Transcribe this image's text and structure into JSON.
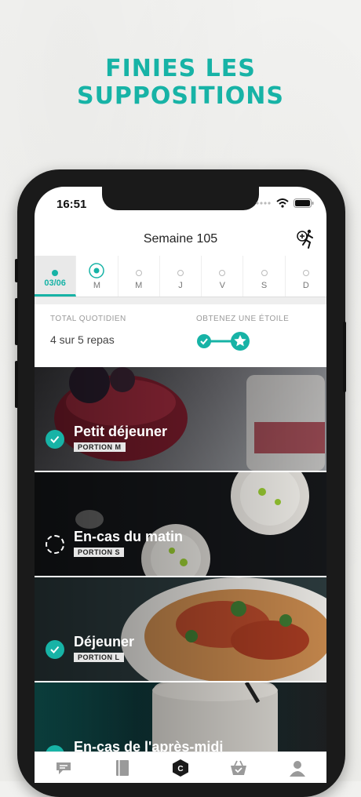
{
  "headline": "FINIES LES SUPPOSITIONS",
  "status": {
    "time": "16:51"
  },
  "header": {
    "title": "Semaine 105"
  },
  "days": [
    {
      "label": "03/06",
      "state": "active"
    },
    {
      "label": "M",
      "state": "ring"
    },
    {
      "label": "M",
      "state": "empty"
    },
    {
      "label": "J",
      "state": "empty"
    },
    {
      "label": "V",
      "state": "empty"
    },
    {
      "label": "S",
      "state": "empty"
    },
    {
      "label": "D",
      "state": "empty"
    }
  ],
  "summary": {
    "total_label": "TOTAL QUOTIDIEN",
    "total_value": "4 sur 5 repas",
    "star_label": "OBTENEZ UNE ÉTOILE"
  },
  "meals": [
    {
      "title": "Petit déjeuner",
      "portion": "PORTION  M",
      "done": true
    },
    {
      "title": "En-cas du matin",
      "portion": "PORTION  S",
      "done": false
    },
    {
      "title": "Déjeuner",
      "portion": "PORTION  L",
      "done": true
    },
    {
      "title": "En-cas de l'après-midi",
      "portion": "",
      "done": true
    }
  ],
  "tabbar": {
    "center_letter": "C"
  },
  "colors": {
    "accent": "#17b3a6"
  },
  "icons": [
    "runner-icon",
    "chat-icon",
    "book-icon",
    "logo-icon",
    "basket-icon",
    "profile-icon"
  ]
}
